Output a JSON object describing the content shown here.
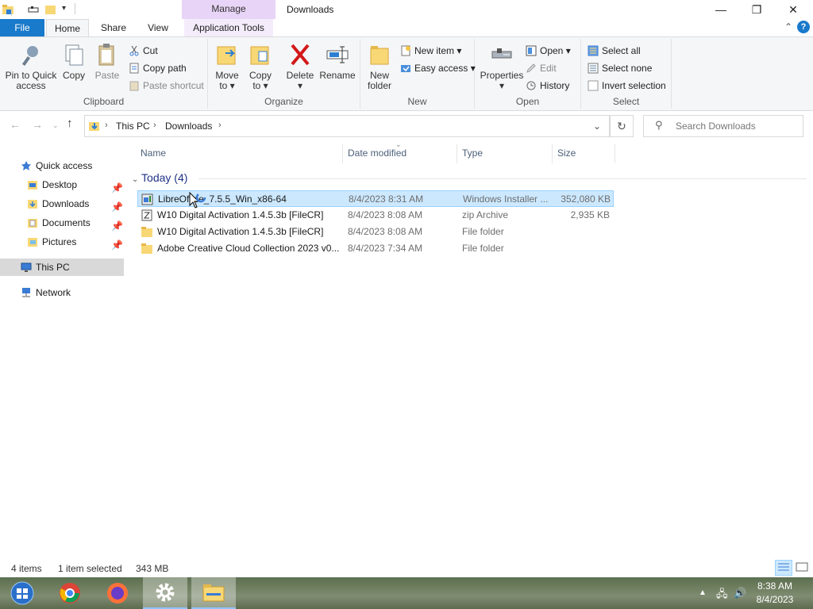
{
  "window": {
    "title": "Downloads",
    "context_tab": "Manage",
    "minimize": "—",
    "maximize": "❐",
    "close": "✕"
  },
  "ribbon_tabs": {
    "file": "File",
    "home": "Home",
    "share": "Share",
    "view": "View",
    "app_tools": "Application Tools",
    "help": "?"
  },
  "clipboard": {
    "label": "Clipboard",
    "pin": [
      "Pin to Quick",
      "access"
    ],
    "copy": "Copy",
    "paste": "Paste",
    "cut": "Cut",
    "copy_path": "Copy path",
    "paste_shortcut": "Paste shortcut"
  },
  "organize": {
    "label": "Organize",
    "move_to": [
      "Move",
      "to ▾"
    ],
    "copy_to": [
      "Copy",
      "to ▾"
    ],
    "delete": [
      "Delete",
      "▾"
    ],
    "rename": "Rename"
  },
  "new_group": {
    "label": "New",
    "new_folder": [
      "New",
      "folder"
    ],
    "new_item": "New item ▾",
    "easy_access": "Easy access ▾"
  },
  "open_group": {
    "label": "Open",
    "properties": [
      "Properties",
      "▾"
    ],
    "open": "Open ▾",
    "edit": "Edit",
    "history": "History"
  },
  "select_group": {
    "label": "Select",
    "select_all": "Select all",
    "select_none": "Select none",
    "invert": "Invert selection"
  },
  "address": {
    "crumb1": "This PC",
    "crumb2": "Downloads",
    "search_placeholder": "Search Downloads"
  },
  "nav": {
    "quick_access": "Quick access",
    "desktop": "Desktop",
    "downloads": "Downloads",
    "documents": "Documents",
    "pictures": "Pictures",
    "this_pc": "This PC",
    "network": "Network"
  },
  "columns": {
    "name": "Name",
    "date": "Date modified",
    "type": "Type",
    "size": "Size"
  },
  "group_header": "Today (4)",
  "files": [
    {
      "name": "LibreOffice_7.5.5_Win_x86-64",
      "date": "8/4/2023 8:31 AM",
      "type": "Windows Installer ...",
      "size": "352,080 KB"
    },
    {
      "name": "W10 Digital Activation 1.4.5.3b [FileCR]",
      "date": "8/4/2023 8:08 AM",
      "type": "zip Archive",
      "size": "2,935 KB"
    },
    {
      "name": "W10 Digital Activation 1.4.5.3b [FileCR]",
      "date": "8/4/2023 8:08 AM",
      "type": "File folder",
      "size": ""
    },
    {
      "name": "Adobe Creative Cloud Collection 2023 v0...",
      "date": "8/4/2023 7:34 AM",
      "type": "File folder",
      "size": ""
    }
  ],
  "status": {
    "items": "4 items",
    "selected": "1 item selected",
    "size": "343 MB"
  },
  "clock": {
    "time": "8:38 AM",
    "date": "8/4/2023"
  },
  "colors": {
    "accent": "#1979ca",
    "manage_tab": "#e8d4f6",
    "selection": "#cce8ff",
    "folder": "#f8d775"
  }
}
